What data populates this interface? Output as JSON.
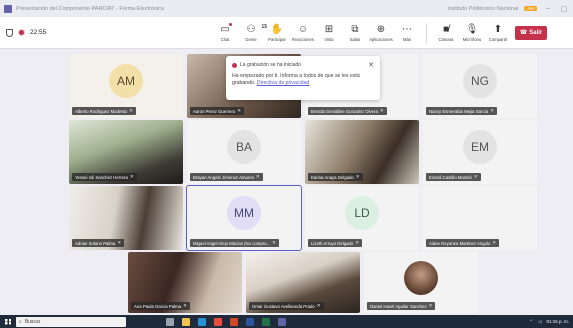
{
  "window": {
    "title": "Presentación del Componente PARCIAT - Forma Electrónica",
    "right_text": "Instituto Politécnico Nacional",
    "right_badge": "AM"
  },
  "controls": {
    "timer": "22:55",
    "buttons": [
      {
        "label": "Chat",
        "icon": "chat-icon"
      },
      {
        "label": "Gente",
        "icon": "people-icon",
        "count": "15"
      },
      {
        "label": "Participar",
        "icon": "raise-hand-icon"
      },
      {
        "label": "Reacciones",
        "icon": "reactions-icon"
      },
      {
        "label": "Vista",
        "icon": "view-icon"
      },
      {
        "label": "Salas",
        "icon": "rooms-icon"
      },
      {
        "label": "Aplicaciones",
        "icon": "apps-icon"
      },
      {
        "label": "Más",
        "icon": "more-icon"
      }
    ],
    "media": [
      {
        "label": "Cámara",
        "icon": "camera-off-icon"
      },
      {
        "label": "Micrófono",
        "icon": "mic-off-icon"
      },
      {
        "label": "Compartir",
        "icon": "share-icon"
      }
    ],
    "leave_label": "Salir"
  },
  "toast": {
    "title": "La grabación se ha iniciado",
    "body": "Ha empezado por ti. Informa a todos de que se les está grabando.",
    "link": "Directiva de privacidad"
  },
  "participants": [
    {
      "name": "Alberto Rodriguez Modesto",
      "initials": "AM",
      "avatar_color": "#f3e0a9",
      "video": false
    },
    {
      "name": "Aaron Perez Guerrero",
      "initials": "",
      "video": true
    },
    {
      "name": "Brenda Geraldine Gonzalez Olvera",
      "initials": "",
      "video": false
    },
    {
      "name": "Nancy Esmeralda Mejia Garcia",
      "initials": "NG",
      "avatar_color": "#e3e3e3",
      "video": false
    },
    {
      "name": "Yessei Ioli Sanchez Herrera",
      "initials": "",
      "video": true
    },
    {
      "name": "Brayan Angelo Jimenez Amores",
      "initials": "BA",
      "avatar_color": "#e3e3e3",
      "video": false
    },
    {
      "name": "Karina Anaya Delgado",
      "initials": "",
      "video": true
    },
    {
      "name": "Erandi Castillo Montiel",
      "initials": "EM",
      "avatar_color": "#e3e3e3",
      "video": false
    },
    {
      "name": "Adrian Solano Palma",
      "initials": "",
      "video": true
    },
    {
      "name": "Miguel Angel Alejo Macias (No compro...",
      "initials": "MM",
      "avatar_color": "#e0ddf5",
      "video": false
    },
    {
      "name": "Lizeth Arroyo Delgado",
      "initials": "LD",
      "avatar_color": "#dcefe3",
      "video": false
    },
    {
      "name": "Aidee Deyanira Martinez Angulo",
      "initials": "",
      "video": false
    },
    {
      "name": "Ana Paula Garcia Palma",
      "initials": "",
      "video": true
    },
    {
      "name": "Omar Gustavo Avellaneda Prado",
      "initials": "",
      "video": true
    },
    {
      "name": "Daniel Hazel Aguilar Sanchez",
      "initials": "",
      "video": false
    }
  ],
  "taskbar": {
    "search_placeholder": "Buscar",
    "time": "01:15 p. m."
  }
}
